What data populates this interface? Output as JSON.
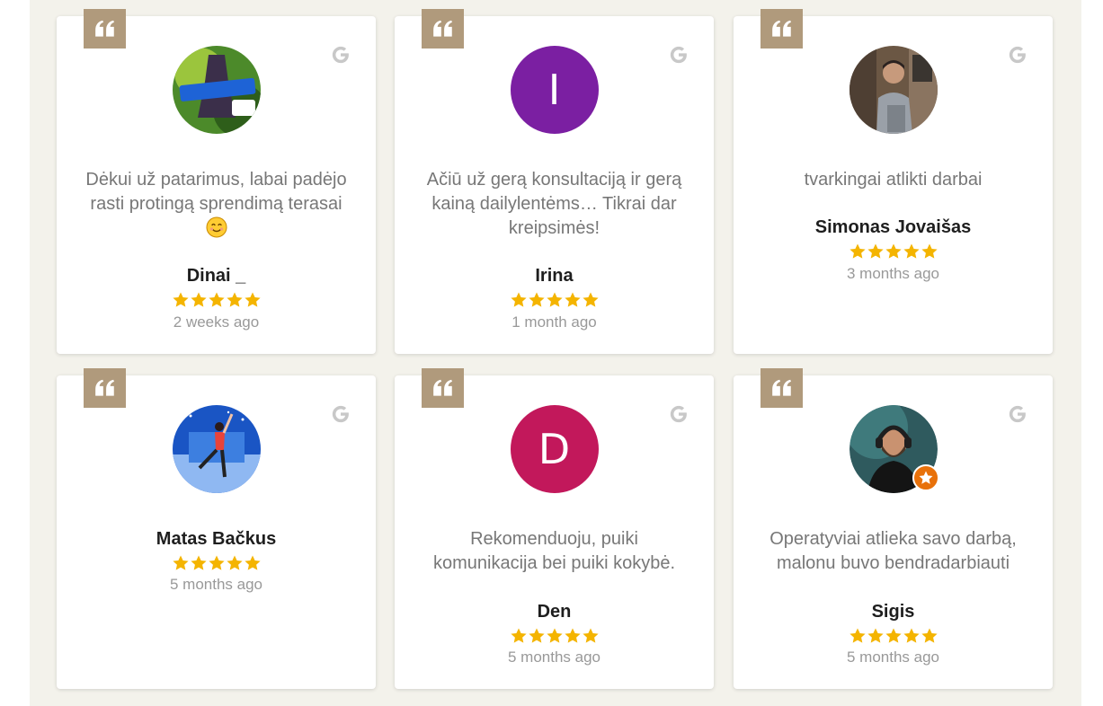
{
  "colors": {
    "panel_bg": "#f3f2eb",
    "quote_badge": "#b09a7c",
    "star": "#f4b400",
    "name_text": "#1e1e1e",
    "review_text": "#777777",
    "time_text": "#999999"
  },
  "icons": {
    "quote": "quote-icon",
    "source": "google-g-icon",
    "rating": "star-icon"
  },
  "reviews": [
    {
      "author": "Dinai _",
      "avatar_type": "photo",
      "text": "Dėkui už patarimus, labai padėjo rasti protingą sprendimą terasai",
      "emoji": "smiling-face-emoji",
      "rating": 5,
      "time": "2 weeks ago"
    },
    {
      "author": "Irina",
      "avatar_type": "letter",
      "avatar_letter": "I",
      "avatar_color": "#7b1fa2",
      "text": "Ačiū už gerą konsultaciją ir gerą kainą dailylentėms… Tikrai dar kreipsimės!",
      "rating": 5,
      "time": "1 month ago"
    },
    {
      "author": "Simonas Jovaišas",
      "avatar_type": "photo",
      "text": "tvarkingai atlikti darbai",
      "rating": 5,
      "time": "3 months ago"
    },
    {
      "author": "Matas Bačkus",
      "avatar_type": "photo",
      "text": "",
      "rating": 5,
      "time": "5 months ago"
    },
    {
      "author": "Den",
      "avatar_type": "letter",
      "avatar_letter": "D",
      "avatar_color": "#c2185b",
      "text": "Rekomenduoju, puiki komunikacija bei puiki kokybė.",
      "rating": 5,
      "time": "5 months ago"
    },
    {
      "author": "Sigis",
      "avatar_type": "photo",
      "text": "Operatyviai atlieka savo darbą, malonu buvo bendradarbiauti",
      "rating": 5,
      "time": "5 months ago"
    }
  ]
}
